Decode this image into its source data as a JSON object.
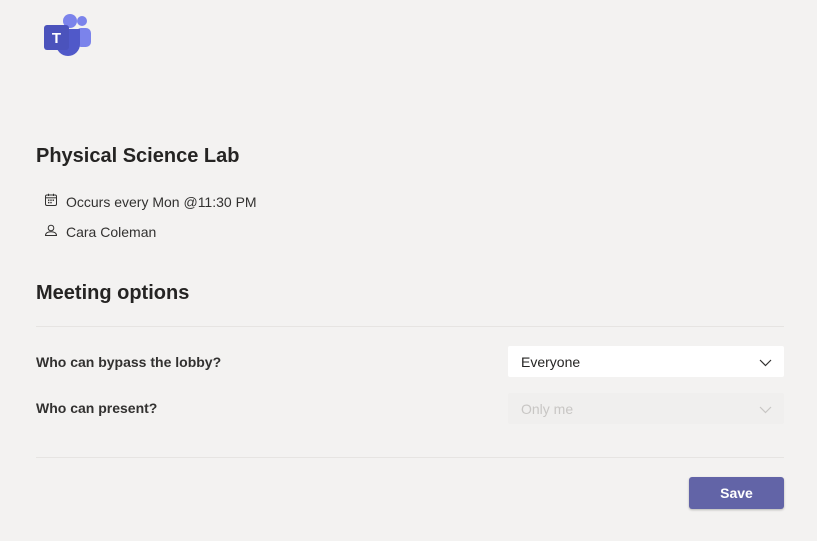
{
  "app": {
    "logo_icon": "teams-logo-icon",
    "brand_color": "#6264a7"
  },
  "meeting": {
    "title": "Physical Science Lab",
    "schedule_icon": "calendar-icon",
    "schedule": "Occurs every Mon @11:30 PM",
    "organizer_icon": "person-icon",
    "organizer": "Cara Coleman"
  },
  "options": {
    "heading": "Meeting options",
    "bypass_lobby": {
      "label": "Who can bypass the lobby?",
      "value": "Everyone",
      "disabled": false
    },
    "who_can_present": {
      "label": "Who can present?",
      "value": "Only me",
      "disabled": true
    }
  },
  "actions": {
    "save_label": "Save"
  }
}
